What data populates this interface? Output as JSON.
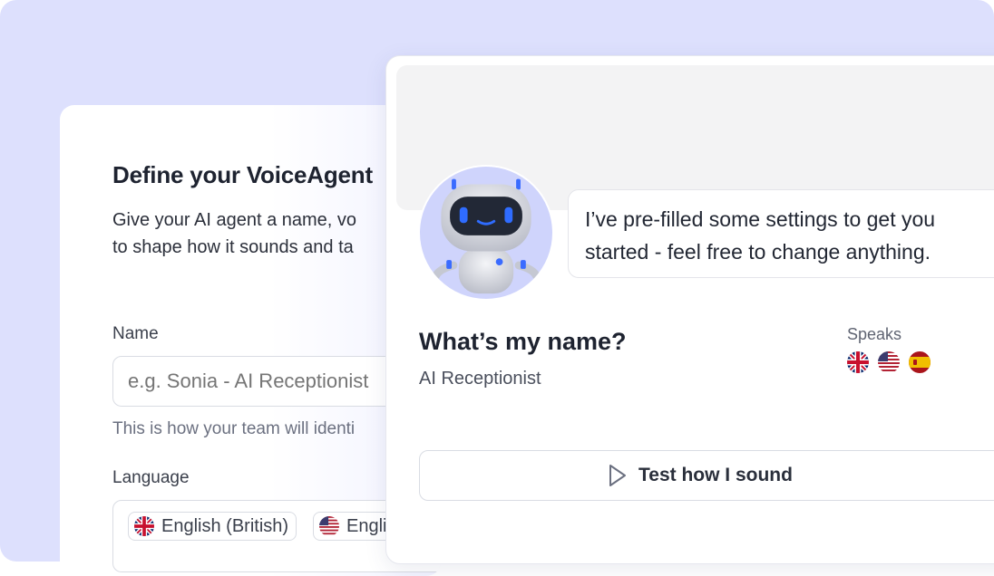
{
  "define": {
    "title": "Define your VoiceAgent",
    "desc_line1": "Give your AI agent a name, vo",
    "desc_line2": "to shape how it sounds and ta",
    "name_label": "Name",
    "name_placeholder": "e.g. Sonia - AI Receptionist",
    "name_helper": "This is how your team will identi",
    "language_label": "Language",
    "languages": [
      {
        "label": "English (British)",
        "flag": "uk-flag-icon"
      },
      {
        "label": "English (American)",
        "flag": "us-flag-icon"
      }
    ]
  },
  "agent": {
    "message_line1": "I’ve pre-filled some settings to get you",
    "message_line2": "started - feel free to change anything.",
    "name": "What’s my name?",
    "role": "AI Receptionist",
    "speaks_label": "Speaks",
    "speaks_flags": [
      "uk-flag-icon",
      "us-flag-icon",
      "spain-flag-icon"
    ],
    "test_button": "Test how I sound",
    "avatar": "robot-avatar"
  },
  "colors": {
    "background": "#dde0fd",
    "avatar_bg": "#cfd4fc",
    "robot_eyes": "#2f6cff"
  }
}
